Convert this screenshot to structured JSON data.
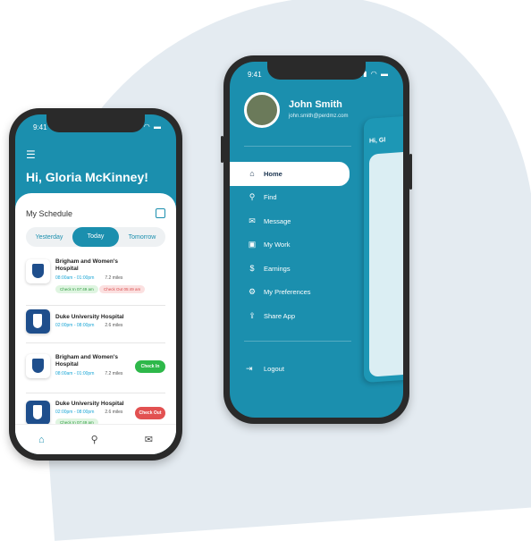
{
  "status_time": "9:41",
  "phone_left": {
    "greeting": "Hi, Gloria McKinney!",
    "schedule_title": "My Schedule",
    "tabs": [
      {
        "label": "Yesterday"
      },
      {
        "label": "Today",
        "active": true
      },
      {
        "label": "Tomorrow"
      }
    ],
    "items": [
      {
        "name": "Brigham and Women's Hospital",
        "logo": "BWH",
        "time": "08:00am - 01:00pm",
        "distance": "7.2 miles",
        "check_in": "Check In 07:49 am",
        "check_out": "Check Out 05:49 am"
      },
      {
        "name": "Duke University Hospital",
        "logo": "Duke",
        "time": "02:00pm - 08:00pm",
        "distance": "2.6 miles"
      },
      {
        "name": "Brigham and Women's Hospital",
        "logo": "BWH",
        "time": "08:00am - 01:00pm",
        "distance": "7.2 miles",
        "action": "Check In"
      },
      {
        "name": "Duke University Hospital",
        "logo": "Duke",
        "time": "02:00pm - 08:00pm",
        "distance": "2.6 miles",
        "check_in": "Check In 07:49 am",
        "action": "Check Out"
      }
    ],
    "tabbar": [
      {
        "icon": "home-icon"
      },
      {
        "icon": "search-icon"
      },
      {
        "icon": "mail-icon"
      }
    ]
  },
  "phone_right": {
    "user_name": "John Smith",
    "email": "john.smith@perdmz.com",
    "menu": [
      {
        "label": "Home",
        "icon": "home-icon",
        "active": true
      },
      {
        "label": "Find",
        "icon": "search-icon"
      },
      {
        "label": "Message",
        "icon": "mail-icon"
      },
      {
        "label": "My Work",
        "icon": "briefcase-icon"
      },
      {
        "label": "Earnings",
        "icon": "dollar-icon"
      },
      {
        "label": "My Preferences",
        "icon": "gear-icon"
      },
      {
        "label": "Share App",
        "icon": "share-icon"
      }
    ],
    "logout": "Logout",
    "mini_greeting": "Hi, Gl"
  },
  "colors": {
    "primary": "#1b8fae",
    "green": "#2eb84a",
    "red": "#e25151"
  }
}
